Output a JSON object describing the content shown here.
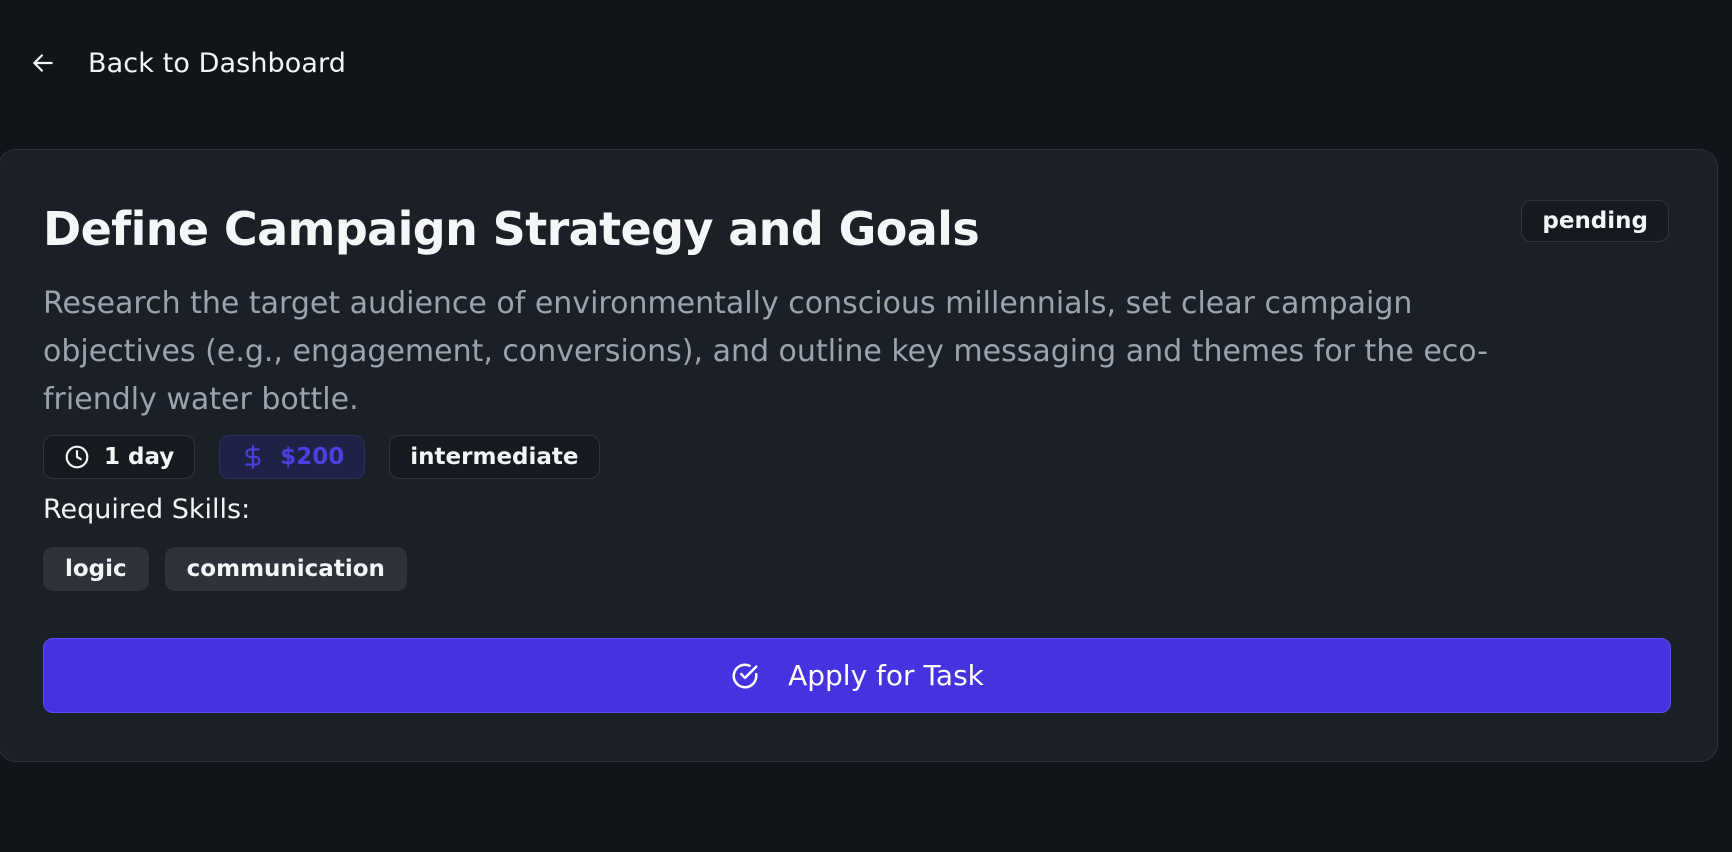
{
  "nav": {
    "back_label": "Back to Dashboard",
    "back_icon": "arrow-left-icon"
  },
  "task": {
    "title": "Define Campaign Strategy and Goals",
    "status": "pending",
    "description": "Research the target audience of environmentally conscious millennials, set clear campaign objectives (e.g., engagement, conversions), and outline key messaging and themes for the eco-friendly water bottle.",
    "duration": "1 day",
    "duration_icon": "clock-icon",
    "price": "$200",
    "price_icon": "dollar-icon",
    "difficulty": "intermediate",
    "skills_heading": "Required Skills:",
    "skills": [
      "logic",
      "communication"
    ],
    "apply_label": "Apply for Task",
    "apply_icon": "check-circle-icon"
  },
  "colors": {
    "background": "#111419",
    "card": "#1b1f26",
    "accent": "#4633e0",
    "price_text": "#4a3fe0",
    "muted_text": "#9ca3af"
  }
}
